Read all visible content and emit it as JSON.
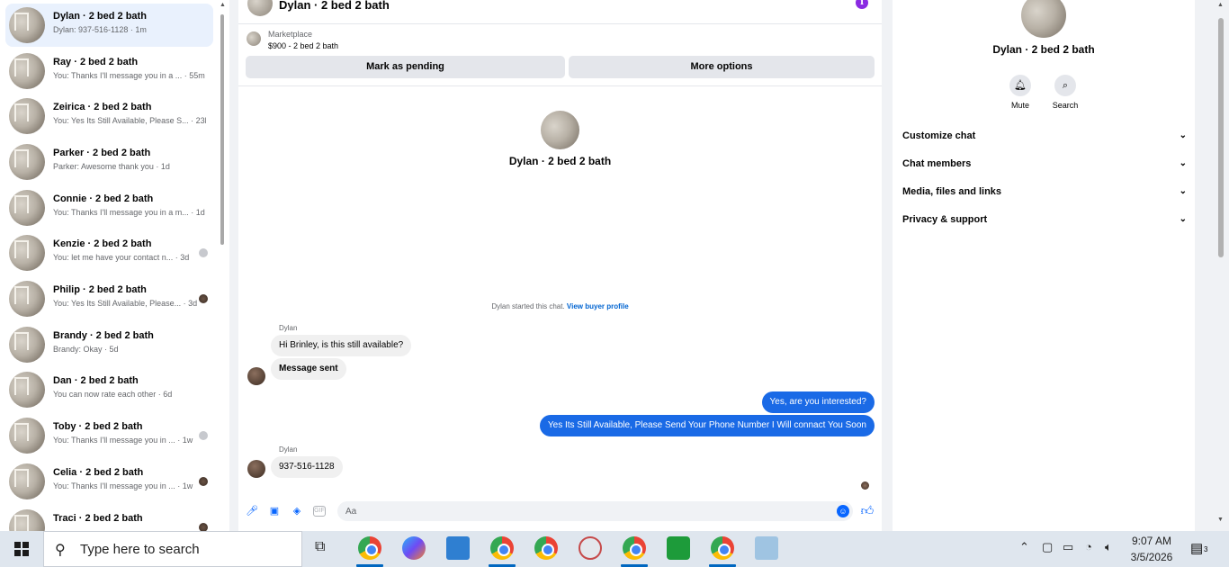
{
  "conversations": [
    {
      "name": "Dylan · 2 bed 2 bath",
      "snippet": "Dylan: 937-516-1128 · 1m",
      "active": true
    },
    {
      "name": "Ray · 2 bed 2 bath",
      "snippet": "You: Thanks I'll message you in a ... · 55m"
    },
    {
      "name": "Zeirica · 2 bed 2 bath",
      "snippet": "You: Yes Its Still Available, Please S... · 23h"
    },
    {
      "name": "Parker · 2 bed 2 bath",
      "snippet": "Parker: Awesome thank you · 1d"
    },
    {
      "name": "Connie · 2 bed 2 bath",
      "snippet": "You: Thanks I'll message you in a m... · 1d"
    },
    {
      "name": "Kenzie · 2 bed 2 bath",
      "snippet": "You: let me have your contact n... · 3d"
    },
    {
      "name": "Philip · 2 bed 2 bath",
      "snippet": "You: Yes Its Still Available, Please... · 3d"
    },
    {
      "name": "Brandy · 2 bed 2 bath",
      "snippet": "Brandy: Okay · 5d"
    },
    {
      "name": "Dan · 2 bed 2 bath",
      "snippet": "You can now rate each other · 6d"
    },
    {
      "name": "Toby · 2 bed 2 bath",
      "snippet": "You: Thanks I'll message you in ... · 1w"
    },
    {
      "name": "Celia · 2 bed 2 bath",
      "snippet": "You: Thanks I'll message you in ... · 1w"
    },
    {
      "name": "Traci · 2 bed 2 bath",
      "snippet": ""
    }
  ],
  "chat": {
    "title": "Dylan · 2 bed 2 bath",
    "marketplace_label": "Marketplace",
    "listing": "$900 - 2 bed 2 bath",
    "mark_pending": "Mark as pending",
    "more_options": "More options",
    "intro_name": "Dylan · 2 bed 2 bath",
    "started_text": "Dylan started this chat.",
    "view_buyer": "View buyer profile",
    "sender1": "Dylan",
    "msg1": "Hi Brinley, is this still available?",
    "msg2": "Message sent",
    "msg3": "Yes, are you interested?",
    "msg4": "Yes Its Still Available, Please Send Your Phone Number I Will connact You Soon",
    "sender2": "Dylan",
    "msg5": "937-516-1128",
    "input_placeholder": "Aa"
  },
  "details": {
    "name": "Dylan · 2 bed 2 bath",
    "mute": "Mute",
    "search": "Search",
    "sections": [
      "Customize chat",
      "Chat members",
      "Media, files and links",
      "Privacy & support"
    ]
  },
  "taskbar": {
    "search_placeholder": "Type here to search",
    "time": "9:07 AM",
    "date": "3/5/2026",
    "notifications": "3"
  },
  "colors": {
    "accent": "#0866ff",
    "outgoing_bubble": "#1a6ae6",
    "active_row": "#e9f1fd"
  }
}
